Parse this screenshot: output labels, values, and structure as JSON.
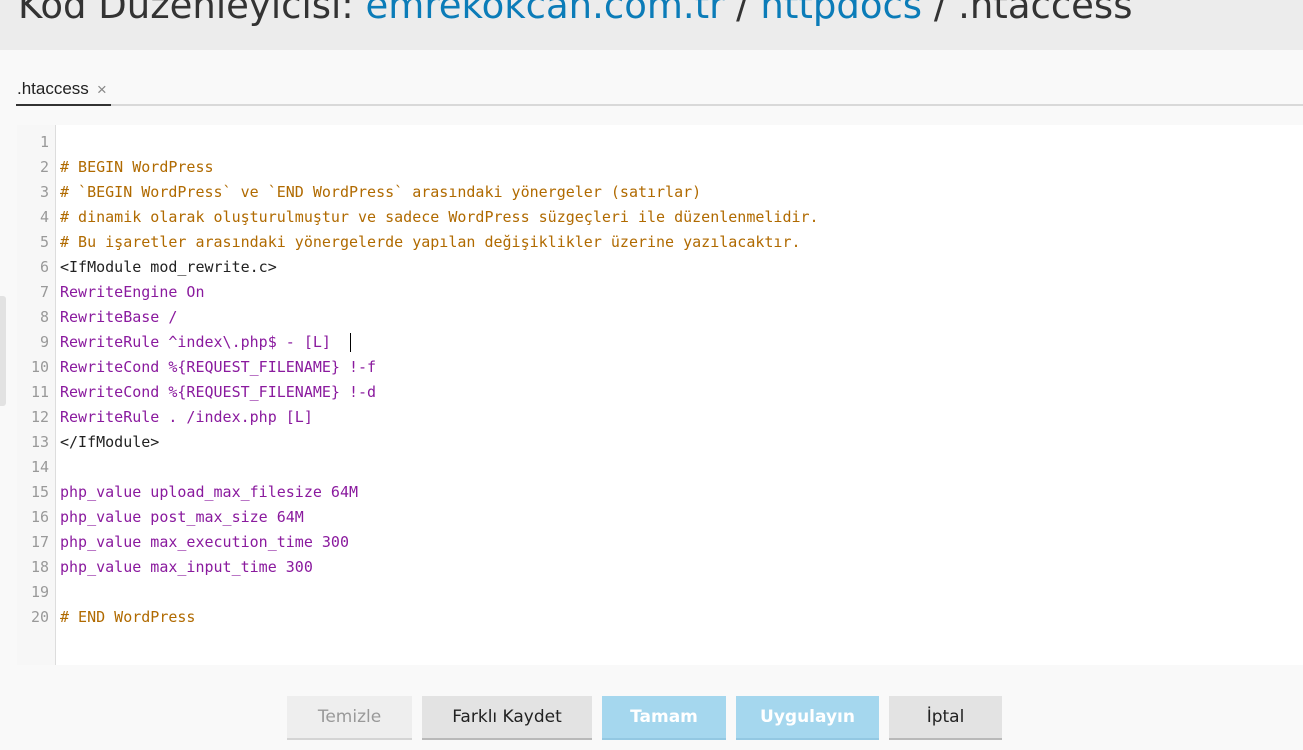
{
  "header": {
    "title_prefix": "Kod Düzenleyicisi:",
    "crumb_domain": "emrekokcan.com.tr",
    "separator": "/",
    "crumb_folder": "httpdocs",
    "crumb_file": ".htaccess"
  },
  "tabs": [
    {
      "label": ".htaccess",
      "close": "×"
    }
  ],
  "editor": {
    "line_numbers": [
      "1",
      "2",
      "3",
      "4",
      "5",
      "6",
      "7",
      "8",
      "9",
      "10",
      "11",
      "12",
      "13",
      "14",
      "15",
      "16",
      "17",
      "18",
      "19",
      "20"
    ],
    "lines": [
      "",
      "# BEGIN WordPress",
      "# `BEGIN WordPress` ve `END WordPress` arasındaki yönergeler (satırlar)",
      "# dinamik olarak oluşturulmuştur ve sadece WordPress süzgeçleri ile düzenlenmelidir.",
      "# Bu işaretler arasındaki yönergelerde yapılan değişiklikler üzerine yazılacaktır.",
      "<IfModule mod_rewrite.c>",
      "RewriteEngine On",
      "RewriteBase /",
      "RewriteRule ^index\\.php$ - [L]",
      "RewriteCond %{REQUEST_FILENAME} !-f",
      "RewriteCond %{REQUEST_FILENAME} !-d",
      "RewriteRule . /index.php [L]",
      "</IfModule>",
      "",
      "php_value upload_max_filesize 64M",
      "php_value post_max_size 64M",
      "php_value max_execution_time 300",
      "php_value max_input_time 300",
      "",
      "# END WordPress"
    ]
  },
  "buttons": {
    "clear": "Temizle",
    "save_as": "Farklı Kaydet",
    "ok": "Tamam",
    "apply": "Uygulayın",
    "cancel": "İptal"
  },
  "colors": {
    "link": "#0b7cb8",
    "comment": "#b06a00",
    "keyword": "#8a1a9e",
    "number": "#0e7a5a",
    "primary_button": "#a5d7ee"
  }
}
